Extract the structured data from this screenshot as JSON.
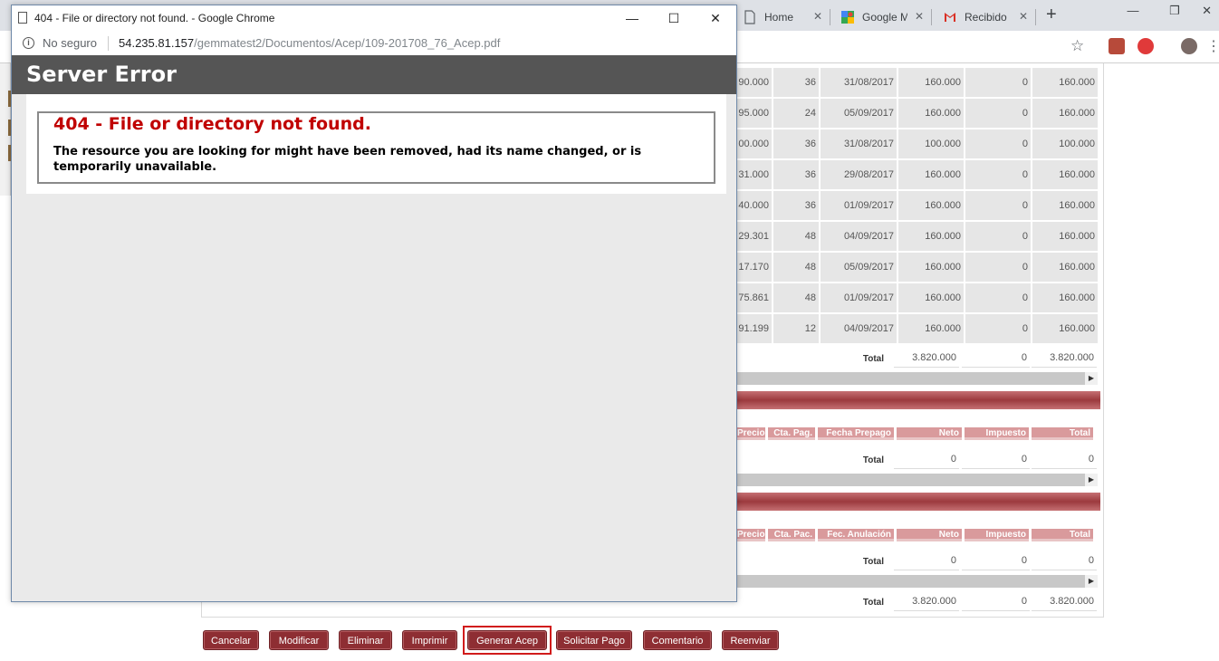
{
  "background_browser": {
    "tabs": [
      {
        "label": "Home",
        "icon": "document-icon"
      },
      {
        "label": "Google M",
        "icon": "google-maps-icon"
      },
      {
        "label": "Recibido",
        "icon": "gmail-icon"
      }
    ],
    "new_tab": "+",
    "window_controls": {
      "minimize": "—",
      "restore": "❐",
      "close": "✕"
    },
    "bookmark_star": "☆"
  },
  "popup": {
    "window_title": "404 - File or directory not found. - Google Chrome",
    "controls": {
      "minimize": "—",
      "maximize": "☐",
      "close": "✕"
    },
    "security_label": "No seguro",
    "url_host": "54.235.81.157",
    "url_path": "/gemmatest2/Documentos/Acep/109-201708_76_Acep.pdf",
    "banner_title": "Server Error",
    "error_heading": "404 - File or directory not found.",
    "error_message": "The resource you are looking for might have been removed, had its name changed, or is temporarily unavailable."
  },
  "data_table": {
    "rows": [
      {
        "c1": "90.000",
        "c2": "36",
        "c3": "31/08/2017",
        "c4": "160.000",
        "c5": "0",
        "c6": "160.000"
      },
      {
        "c1": "95.000",
        "c2": "24",
        "c3": "05/09/2017",
        "c4": "160.000",
        "c5": "0",
        "c6": "160.000"
      },
      {
        "c1": "00.000",
        "c2": "36",
        "c3": "31/08/2017",
        "c4": "100.000",
        "c5": "0",
        "c6": "100.000"
      },
      {
        "c1": "31.000",
        "c2": "36",
        "c3": "29/08/2017",
        "c4": "160.000",
        "c5": "0",
        "c6": "160.000"
      },
      {
        "c1": "40.000",
        "c2": "36",
        "c3": "01/09/2017",
        "c4": "160.000",
        "c5": "0",
        "c6": "160.000"
      },
      {
        "c1": "29.301",
        "c2": "48",
        "c3": "04/09/2017",
        "c4": "160.000",
        "c5": "0",
        "c6": "160.000"
      },
      {
        "c1": "17.170",
        "c2": "48",
        "c3": "05/09/2017",
        "c4": "160.000",
        "c5": "0",
        "c6": "160.000"
      },
      {
        "c1": "75.861",
        "c2": "48",
        "c3": "01/09/2017",
        "c4": "160.000",
        "c5": "0",
        "c6": "160.000"
      },
      {
        "c1": "91.199",
        "c2": "12",
        "c3": "04/09/2017",
        "c4": "160.000",
        "c5": "0",
        "c6": "160.000"
      }
    ],
    "total": {
      "label": "Total",
      "neto": "3.820.000",
      "impuesto": "0",
      "total": "3.820.000"
    }
  },
  "prepago_table": {
    "headers": [
      "Precio",
      "Cta. Pag.",
      "Fecha Prepago",
      "Neto",
      "Impuesto",
      "Total"
    ],
    "total": {
      "label": "Total",
      "neto": "0",
      "impuesto": "0",
      "total": "0"
    }
  },
  "anulacion_table": {
    "headers": [
      "Precio",
      "Cta. Pac.",
      "Fec. Anulación",
      "Neto",
      "Impuesto",
      "Total"
    ],
    "total": {
      "label": "Total",
      "neto": "0",
      "impuesto": "0",
      "total": "0"
    }
  },
  "grand_total": {
    "label": "Total",
    "neto": "3.820.000",
    "impuesto": "0",
    "total": "3.820.000"
  },
  "actions": {
    "cancelar": "Cancelar",
    "modificar": "Modificar",
    "eliminar": "Eliminar",
    "imprimir": "Imprimir",
    "generar_acep": "Generar Acep",
    "solicitar_pago": "Solicitar Pago",
    "comentario": "Comentario",
    "reenviar": "Reenviar"
  },
  "colors": {
    "button_bg": "#8e2e33",
    "section_band": "#9c3a3e",
    "header_pink": "#d99a9c",
    "error_red": "#c00000",
    "highlight": "#d11b1b"
  }
}
